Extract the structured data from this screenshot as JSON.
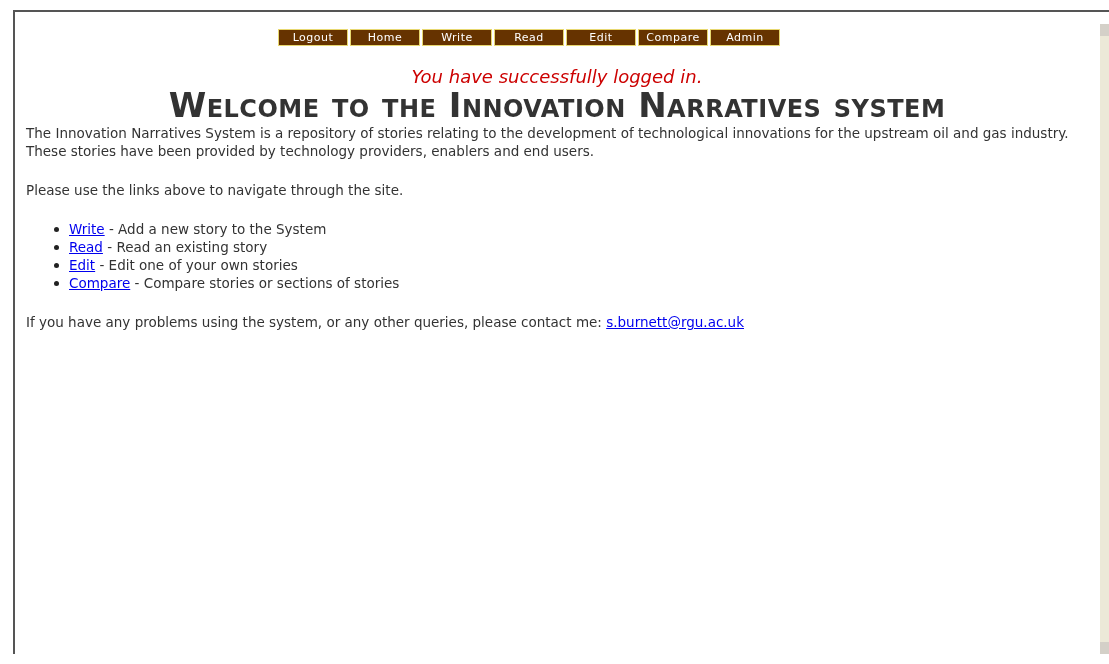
{
  "nav": [
    "Logout",
    "Home",
    "Write",
    "Read",
    "Edit",
    "Compare",
    "Admin"
  ],
  "message": "You have successfully logged in.",
  "heading": "Welcome to the Innovation Narratives system",
  "intro": "The Innovation Narratives System is a repository of stories relating to the development of technological innovations for the upstream oil and gas industry. These stories have been provided by technology providers, enablers and end users.",
  "instruction": "Please use the links above to navigate through the site.",
  "links": [
    {
      "link": "Write",
      "description": "- Add a new story to the System"
    },
    {
      "link": "Read",
      "description": "- Read an existing story"
    },
    {
      "link": "Edit",
      "description": "- Edit one of your own stories"
    },
    {
      "link": "Compare",
      "description": "- Compare stories or sections of stories"
    }
  ],
  "contact": {
    "text": "If you have any problems using the system, or any other queries, please contact me:",
    "link": "s.burnett@rgu.ac.uk"
  }
}
